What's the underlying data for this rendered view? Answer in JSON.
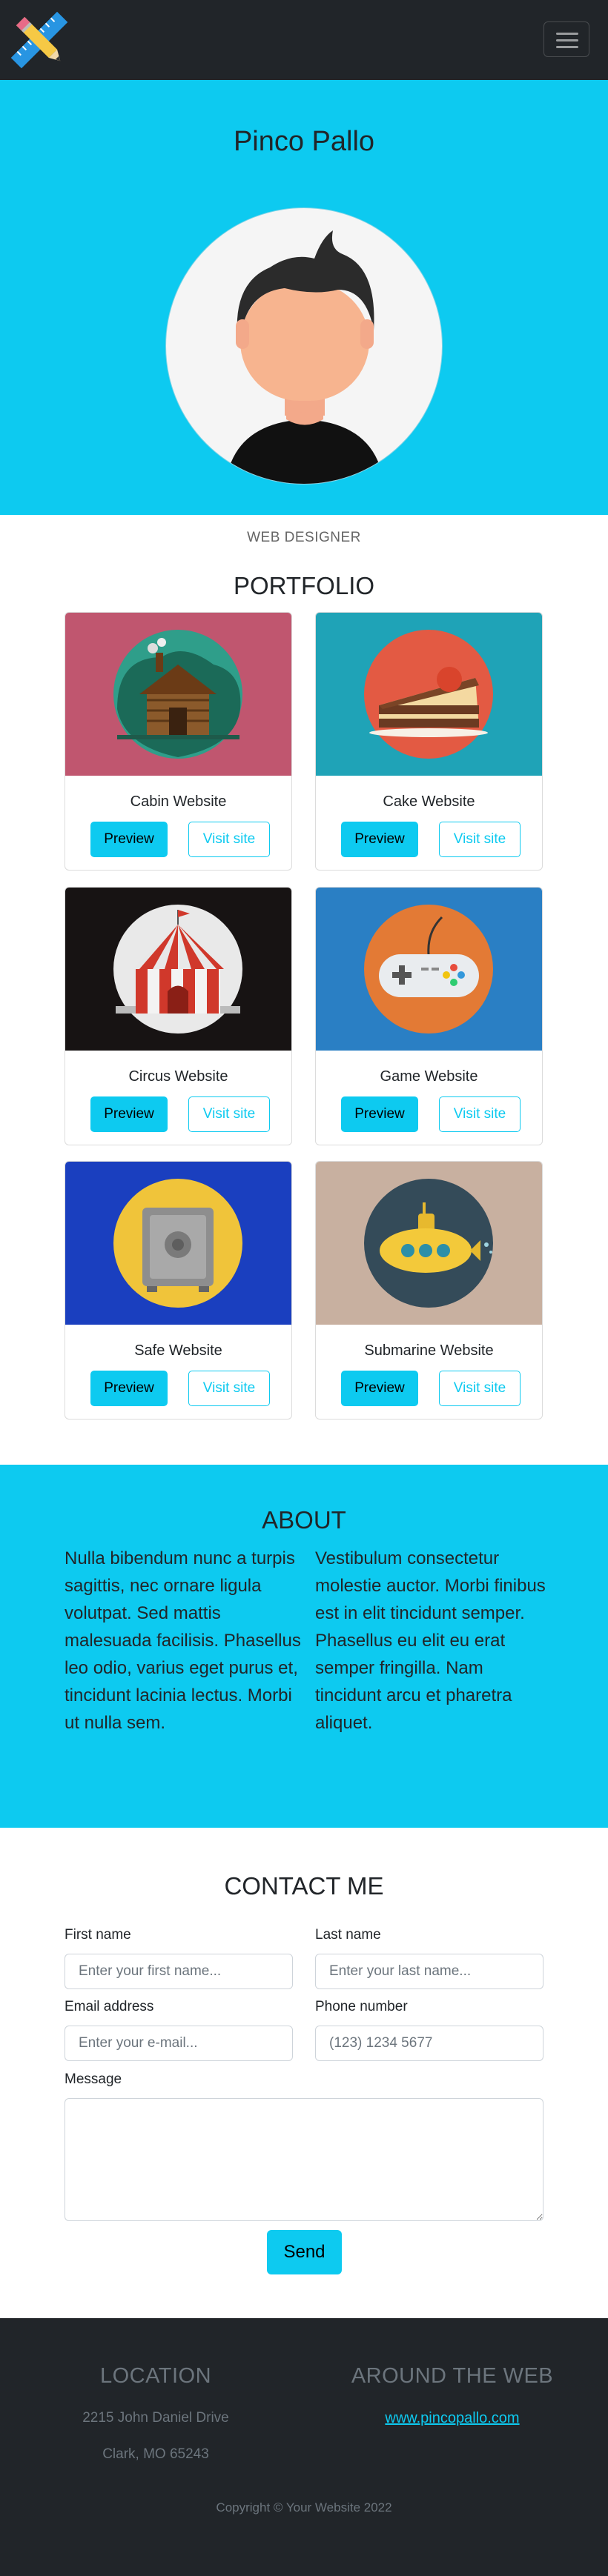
{
  "navbar": {
    "toggle_icon": "hamburger-icon",
    "logo_icon": "pencil-ruler-cross-icon"
  },
  "hero": {
    "title": "Pinco Pallo",
    "subtitle": "WEB DESIGNER",
    "avatar_icon": "man-avatar-icon"
  },
  "portfolio": {
    "title": "PORTFOLIO",
    "preview_label": "Preview",
    "visit_label": "Visit site",
    "items": [
      {
        "title": "Cabin Website",
        "icon": "cabin-icon",
        "bg": "#c0566f"
      },
      {
        "title": "Cake Website",
        "icon": "cake-icon",
        "bg": "#1fa3b7"
      },
      {
        "title": "Circus Website",
        "icon": "circus-tent-icon",
        "bg": "#171313"
      },
      {
        "title": "Game Website",
        "icon": "game-controller-icon",
        "bg": "#2a7fc4"
      },
      {
        "title": "Safe Website",
        "icon": "safe-icon",
        "bg": "#1a3fbf"
      },
      {
        "title": "Submarine Website",
        "icon": "submarine-icon",
        "bg": "#c8b0a0"
      }
    ]
  },
  "about": {
    "title": "ABOUT",
    "col1": "Nulla bibendum nunc a turpis sagittis, nec ornare ligula volutpat. Sed mattis malesuada facilisis. Phasellus leo odio, varius eget purus et, tincidunt lacinia lectus. Morbi ut nulla sem.",
    "col2": "Vestibulum consectetur molestie auctor. Morbi finibus est in elit tincidunt semper. Phasellus eu elit eu erat semper fringilla. Nam tincidunt arcu et pharetra aliquet."
  },
  "contact": {
    "title": "CONTACT ME",
    "first_name_label": "First name",
    "first_name_placeholder": "Enter your first name...",
    "last_name_label": "Last name",
    "last_name_placeholder": "Enter your last name...",
    "email_label": "Email address",
    "email_placeholder": "Enter your e-mail...",
    "phone_label": "Phone number",
    "phone_placeholder": "(123) 1234 5677",
    "message_label": "Message",
    "send_label": "Send"
  },
  "footer": {
    "location_title": "LOCATION",
    "address_line1": "2215 John Daniel Drive",
    "address_line2": "Clark, MO 65243",
    "web_title": "AROUND THE WEB",
    "web_link": "www.pincopallo.com",
    "copyright": "Copyright © Your Website 2022"
  },
  "colors": {
    "accent": "#0dcaf0",
    "dark": "#212529",
    "muted": "#6c757d"
  }
}
